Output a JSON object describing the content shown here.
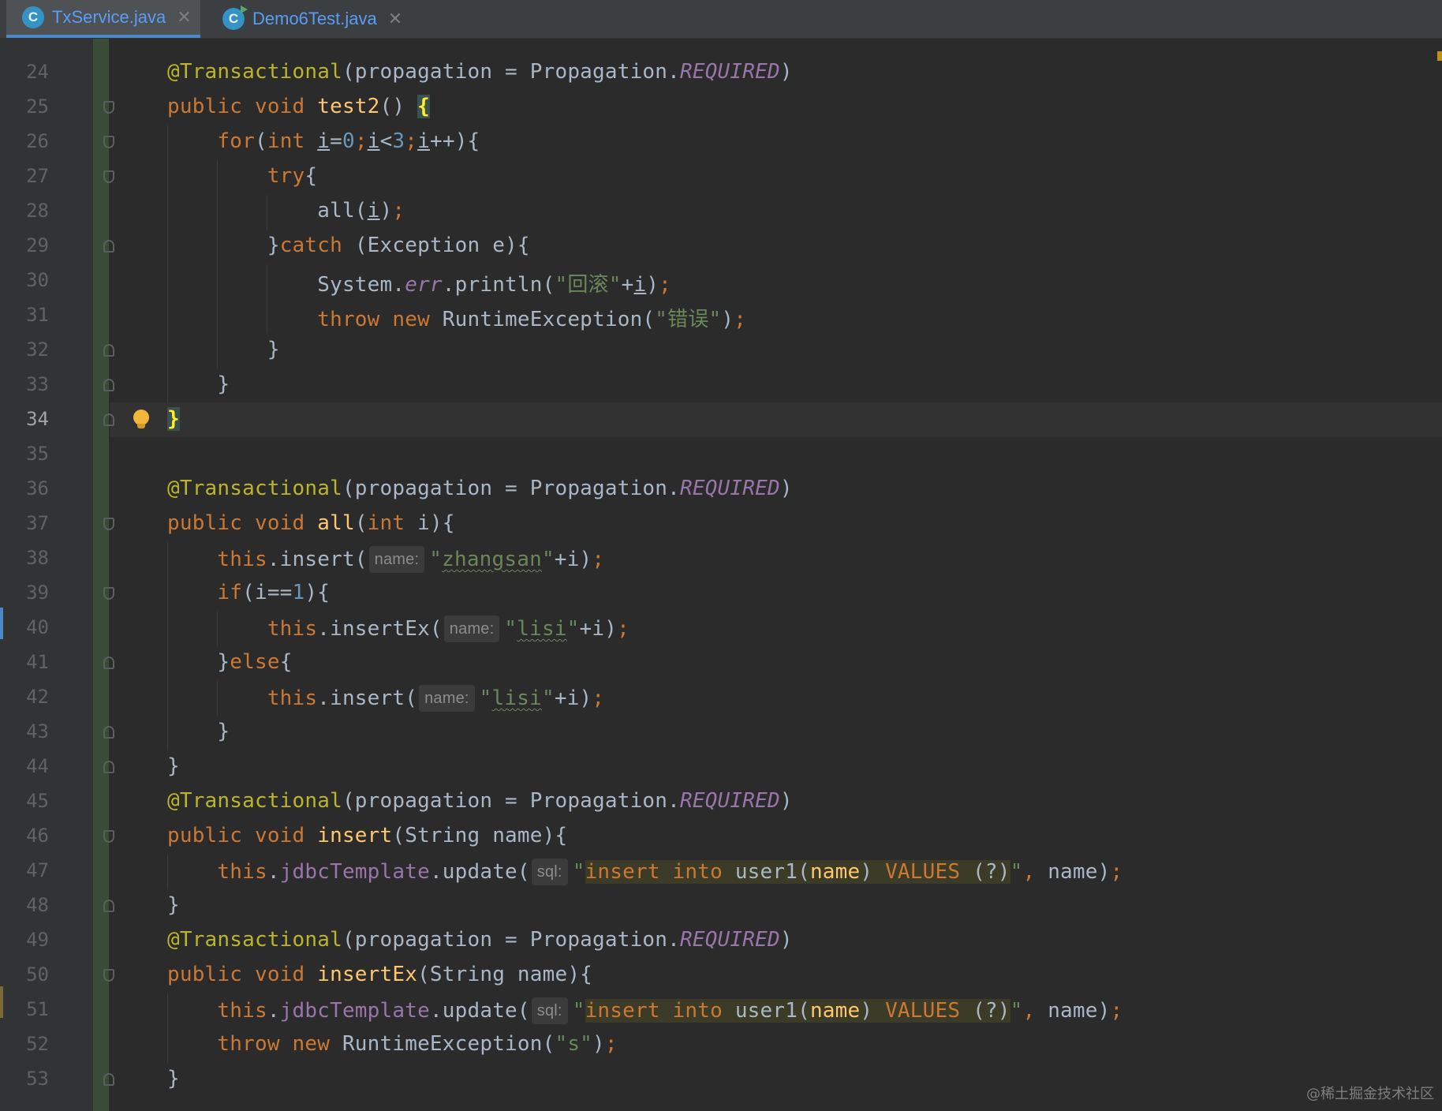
{
  "tabs": [
    {
      "label": "TxService.java",
      "icon": "java-class-icon",
      "icon_letter": "C",
      "active": true
    },
    {
      "label": "Demo6Test.java",
      "icon": "java-test-class-icon",
      "icon_letter": "C",
      "active": false
    }
  ],
  "close_glyph": "✕",
  "current_line": "34",
  "watermark": "@稀土掘金技术社区",
  "colors": {
    "background": "#2b2b2b",
    "gutter": "#313335",
    "keyword": "#cc7832",
    "annotation": "#bbb529",
    "string": "#6a8759",
    "number": "#6897bb",
    "method": "#ffc66d",
    "constant": "#9876aa",
    "default": "#a9b7c6"
  },
  "lines": [
    {
      "n": "24",
      "parts": [
        [
          "@Transactional",
          "ann"
        ],
        [
          "(propagation = Propagation.",
          ""
        ],
        [
          "REQUIRED",
          "const"
        ],
        [
          ")",
          ""
        ]
      ]
    },
    {
      "n": "25",
      "parts": [
        [
          "public void ",
          "kw"
        ],
        [
          "test2",
          "fn"
        ],
        [
          "() ",
          ""
        ],
        [
          "{",
          "brace-hl"
        ]
      ]
    },
    {
      "n": "26",
      "parts": [
        [
          "    for",
          "kw"
        ],
        [
          "(",
          ""
        ],
        [
          "int ",
          "kw"
        ],
        [
          "i",
          "var"
        ],
        [
          "=",
          ""
        ],
        [
          "0",
          "num"
        ],
        [
          ";",
          "punc"
        ],
        [
          "i",
          "var"
        ],
        [
          "<",
          ""
        ],
        [
          "3",
          "num"
        ],
        [
          ";",
          "punc"
        ],
        [
          "i",
          "var"
        ],
        [
          "++){",
          ""
        ]
      ]
    },
    {
      "n": "27",
      "parts": [
        [
          "        try",
          "kw"
        ],
        [
          "{",
          ""
        ]
      ]
    },
    {
      "n": "28",
      "parts": [
        [
          "            all(",
          ""
        ],
        [
          "i",
          "var"
        ],
        [
          ")",
          ""
        ],
        [
          ";",
          "punc"
        ]
      ]
    },
    {
      "n": "29",
      "parts": [
        [
          "        }",
          ""
        ],
        [
          "catch ",
          "kw"
        ],
        [
          "(Exception e){",
          ""
        ]
      ]
    },
    {
      "n": "30",
      "parts": [
        [
          "            System.",
          ""
        ],
        [
          "err",
          "italic-field"
        ],
        [
          ".println(",
          ""
        ],
        [
          "\"回滚\"",
          "str"
        ],
        [
          "+",
          ""
        ],
        [
          "i",
          "var"
        ],
        [
          ")",
          ""
        ],
        [
          ";",
          "punc"
        ]
      ]
    },
    {
      "n": "31",
      "parts": [
        [
          "            throw new ",
          "kw"
        ],
        [
          "RuntimeException(",
          ""
        ],
        [
          "\"错误\"",
          "str"
        ],
        [
          ")",
          ""
        ],
        [
          ";",
          "punc"
        ]
      ]
    },
    {
      "n": "32",
      "parts": [
        [
          "        }",
          ""
        ]
      ]
    },
    {
      "n": "33",
      "parts": [
        [
          "    }",
          ""
        ]
      ]
    },
    {
      "n": "34",
      "parts": [
        [
          "}",
          "brace-hl"
        ]
      ]
    },
    {
      "n": "35",
      "parts": []
    },
    {
      "n": "36",
      "parts": [
        [
          "@Transactional",
          "ann"
        ],
        [
          "(propagation = Propagation.",
          ""
        ],
        [
          "REQUIRED",
          "const"
        ],
        [
          ")",
          ""
        ]
      ]
    },
    {
      "n": "37",
      "parts": [
        [
          "public void ",
          "kw"
        ],
        [
          "all",
          "fn"
        ],
        [
          "(",
          ""
        ],
        [
          "int ",
          "kw"
        ],
        [
          "i){",
          ""
        ]
      ]
    },
    {
      "n": "38",
      "parts": [
        [
          "    this",
          "kw"
        ],
        [
          ".insert(",
          ""
        ],
        [
          "name:",
          "hint"
        ],
        [
          "\"",
          "str"
        ],
        [
          "zhangsan",
          "str squig"
        ],
        [
          "\"",
          "str"
        ],
        [
          "+i)",
          ""
        ],
        [
          ";",
          "punc"
        ]
      ]
    },
    {
      "n": "39",
      "parts": [
        [
          "    if",
          "kw"
        ],
        [
          "(i==",
          ""
        ],
        [
          "1",
          "num"
        ],
        [
          "){",
          ""
        ]
      ]
    },
    {
      "n": "40",
      "parts": [
        [
          "        this",
          "kw"
        ],
        [
          ".insertEx(",
          ""
        ],
        [
          "name:",
          "hint"
        ],
        [
          "\"",
          "str"
        ],
        [
          "lisi",
          "str squig"
        ],
        [
          "\"",
          "str"
        ],
        [
          "+i)",
          ""
        ],
        [
          ";",
          "punc"
        ]
      ]
    },
    {
      "n": "41",
      "parts": [
        [
          "    }",
          ""
        ],
        [
          "else",
          "kw"
        ],
        [
          "{",
          ""
        ]
      ]
    },
    {
      "n": "42",
      "parts": [
        [
          "        this",
          "kw"
        ],
        [
          ".insert(",
          ""
        ],
        [
          "name:",
          "hint"
        ],
        [
          "\"",
          "str"
        ],
        [
          "lisi",
          "str squig"
        ],
        [
          "\"",
          "str"
        ],
        [
          "+i)",
          ""
        ],
        [
          ";",
          "punc"
        ]
      ]
    },
    {
      "n": "43",
      "parts": [
        [
          "    }",
          ""
        ]
      ]
    },
    {
      "n": "44",
      "parts": [
        [
          "}",
          ""
        ]
      ]
    },
    {
      "n": "45",
      "parts": [
        [
          "@Transactional",
          "ann"
        ],
        [
          "(propagation = Propagation.",
          ""
        ],
        [
          "REQUIRED",
          "const"
        ],
        [
          ")",
          ""
        ]
      ]
    },
    {
      "n": "46",
      "parts": [
        [
          "public void ",
          "kw"
        ],
        [
          "insert",
          "fn"
        ],
        [
          "(String name){",
          ""
        ]
      ]
    },
    {
      "n": "47",
      "parts": [
        [
          "    this",
          "kw"
        ],
        [
          ".",
          ""
        ],
        [
          "jdbcTemplate",
          "field"
        ],
        [
          ".update(",
          ""
        ],
        [
          "sql:",
          "hint"
        ],
        [
          "\"",
          "str"
        ],
        [
          "insert into ",
          "sql-kw sql-bg"
        ],
        [
          "user1(",
          "sql-id sql-bg"
        ],
        [
          "name",
          "sql-col sql-bg"
        ],
        [
          ") ",
          "sql-id sql-bg"
        ],
        [
          "VALUES ",
          "sql-kw sql-bg"
        ],
        [
          "(?)",
          "sql-id sql-bg"
        ],
        [
          "\"",
          "str"
        ],
        [
          ", ",
          "punc"
        ],
        [
          "name)",
          ""
        ],
        [
          ";",
          "punc"
        ]
      ]
    },
    {
      "n": "48",
      "parts": [
        [
          "}",
          ""
        ]
      ]
    },
    {
      "n": "49",
      "parts": [
        [
          "@Transactional",
          "ann"
        ],
        [
          "(propagation = Propagation.",
          ""
        ],
        [
          "REQUIRED",
          "const"
        ],
        [
          ")",
          ""
        ]
      ]
    },
    {
      "n": "50",
      "parts": [
        [
          "public void ",
          "kw"
        ],
        [
          "insertEx",
          "fn"
        ],
        [
          "(String name){",
          ""
        ]
      ]
    },
    {
      "n": "51",
      "parts": [
        [
          "    this",
          "kw"
        ],
        [
          ".",
          ""
        ],
        [
          "jdbcTemplate",
          "field"
        ],
        [
          ".update(",
          ""
        ],
        [
          "sql:",
          "hint"
        ],
        [
          "\"",
          "str"
        ],
        [
          "insert into ",
          "sql-kw sql-bg"
        ],
        [
          "user1(",
          "sql-id sql-bg"
        ],
        [
          "name",
          "sql-col sql-bg"
        ],
        [
          ") ",
          "sql-id sql-bg"
        ],
        [
          "VALUES ",
          "sql-kw sql-bg"
        ],
        [
          "(?)",
          "sql-id sql-bg"
        ],
        [
          "\"",
          "str"
        ],
        [
          ", ",
          "punc"
        ],
        [
          "name)",
          ""
        ],
        [
          ";",
          "punc"
        ]
      ]
    },
    {
      "n": "52",
      "parts": [
        [
          "    throw new ",
          "kw"
        ],
        [
          "RuntimeException(",
          ""
        ],
        [
          "\"s\"",
          "str"
        ],
        [
          ")",
          ""
        ],
        [
          ";",
          "punc"
        ]
      ]
    },
    {
      "n": "53",
      "parts": [
        [
          "}",
          ""
        ]
      ]
    }
  ]
}
